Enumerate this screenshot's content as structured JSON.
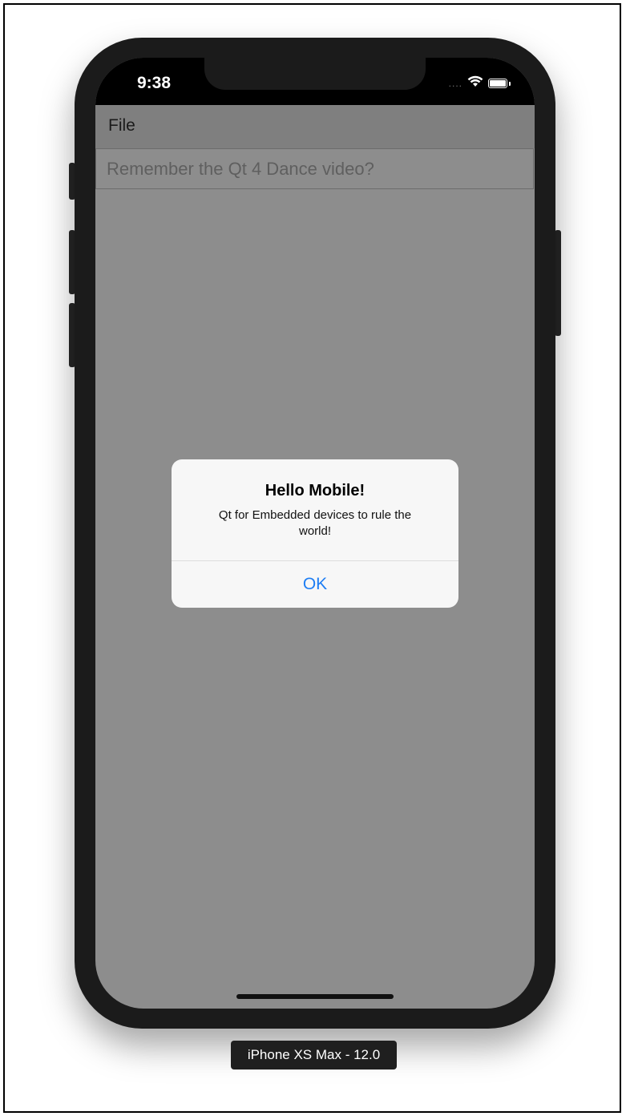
{
  "status_bar": {
    "time": "9:38",
    "signal": "....",
    "wifi_icon": "wifi-icon",
    "battery_icon": "battery-icon"
  },
  "menubar": {
    "file_label": "File"
  },
  "text_field": {
    "value": "Remember the Qt 4 Dance video?"
  },
  "dialog": {
    "title": "Hello Mobile!",
    "message": "Qt for Embedded devices to rule the world!",
    "ok_label": "OK",
    "ok_color": "#1e7ef4"
  },
  "device_label": "iPhone XS Max - 12.0",
  "colors": {
    "screen_background": "#8d8d8d",
    "menubar_background": "#7f7f7f",
    "dialog_background": "#f7f7f7",
    "device_frame": "#1b1b1b"
  }
}
